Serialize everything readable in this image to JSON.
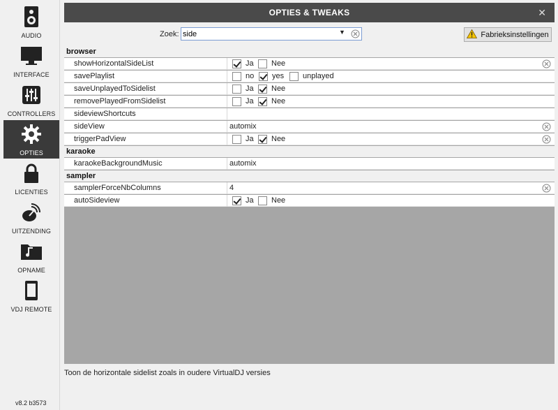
{
  "sidebar": {
    "items": [
      {
        "label": "AUDIO",
        "icon": "speaker-icon"
      },
      {
        "label": "INTERFACE",
        "icon": "monitor-icon"
      },
      {
        "label": "CONTROLLERS",
        "icon": "sliders-icon"
      },
      {
        "label": "OPTIES",
        "icon": "gear-icon",
        "active": true
      },
      {
        "label": "LICENTIES",
        "icon": "lock-icon"
      },
      {
        "label": "UITZENDING",
        "icon": "broadcast-icon"
      },
      {
        "label": "OPNAME",
        "icon": "music-folder-icon"
      },
      {
        "label": "VDJ REMOTE",
        "icon": "tablet-icon"
      }
    ],
    "version": "v8.2 b3573"
  },
  "window": {
    "title": "OPTIES & TWEAKS",
    "close": "✕"
  },
  "search": {
    "label": "Zoek:",
    "value": "side"
  },
  "factory_button": {
    "label": "Fabrieksinstellingen"
  },
  "groups": {
    "browser": "browser",
    "karaoke": "karaoke",
    "sampler": "sampler"
  },
  "rows": {
    "showHorizontalSideList": {
      "name": "showHorizontalSideList",
      "opt1": "Ja",
      "opt2": "Nee",
      "checked": "opt1"
    },
    "savePlaylist": {
      "name": "savePlaylist",
      "opt1": "no",
      "opt2": "yes",
      "opt3": "unplayed",
      "checked": "opt2"
    },
    "saveUnplayedToSidelist": {
      "name": "saveUnplayedToSidelist",
      "opt1": "Ja",
      "opt2": "Nee",
      "checked": "opt2"
    },
    "removePlayedFromSidelist": {
      "name": "removePlayedFromSidelist",
      "opt1": "Ja",
      "opt2": "Nee",
      "checked": "opt2"
    },
    "sideviewShortcuts": {
      "name": "sideviewShortcuts",
      "value": ""
    },
    "sideView": {
      "name": "sideView",
      "value": "automix"
    },
    "triggerPadView": {
      "name": "triggerPadView",
      "opt1": "Ja",
      "opt2": "Nee",
      "checked": "opt2"
    },
    "karaokeBackgroundMusic": {
      "name": "karaokeBackgroundMusic",
      "value": "automix"
    },
    "samplerForceNbColumns": {
      "name": "samplerForceNbColumns",
      "value": "4"
    },
    "autoSideview": {
      "name": "autoSideview",
      "opt1": "Ja",
      "opt2": "Nee",
      "checked": "opt1"
    }
  },
  "description": "Toon de horizontale sidelist zoals in oudere VirtualDJ versies",
  "colors": {
    "titlebar": "#4a4a4a",
    "active_nav": "#3a3a3a",
    "table_bg": "#a6a6a6",
    "warning": "#f5c400"
  }
}
